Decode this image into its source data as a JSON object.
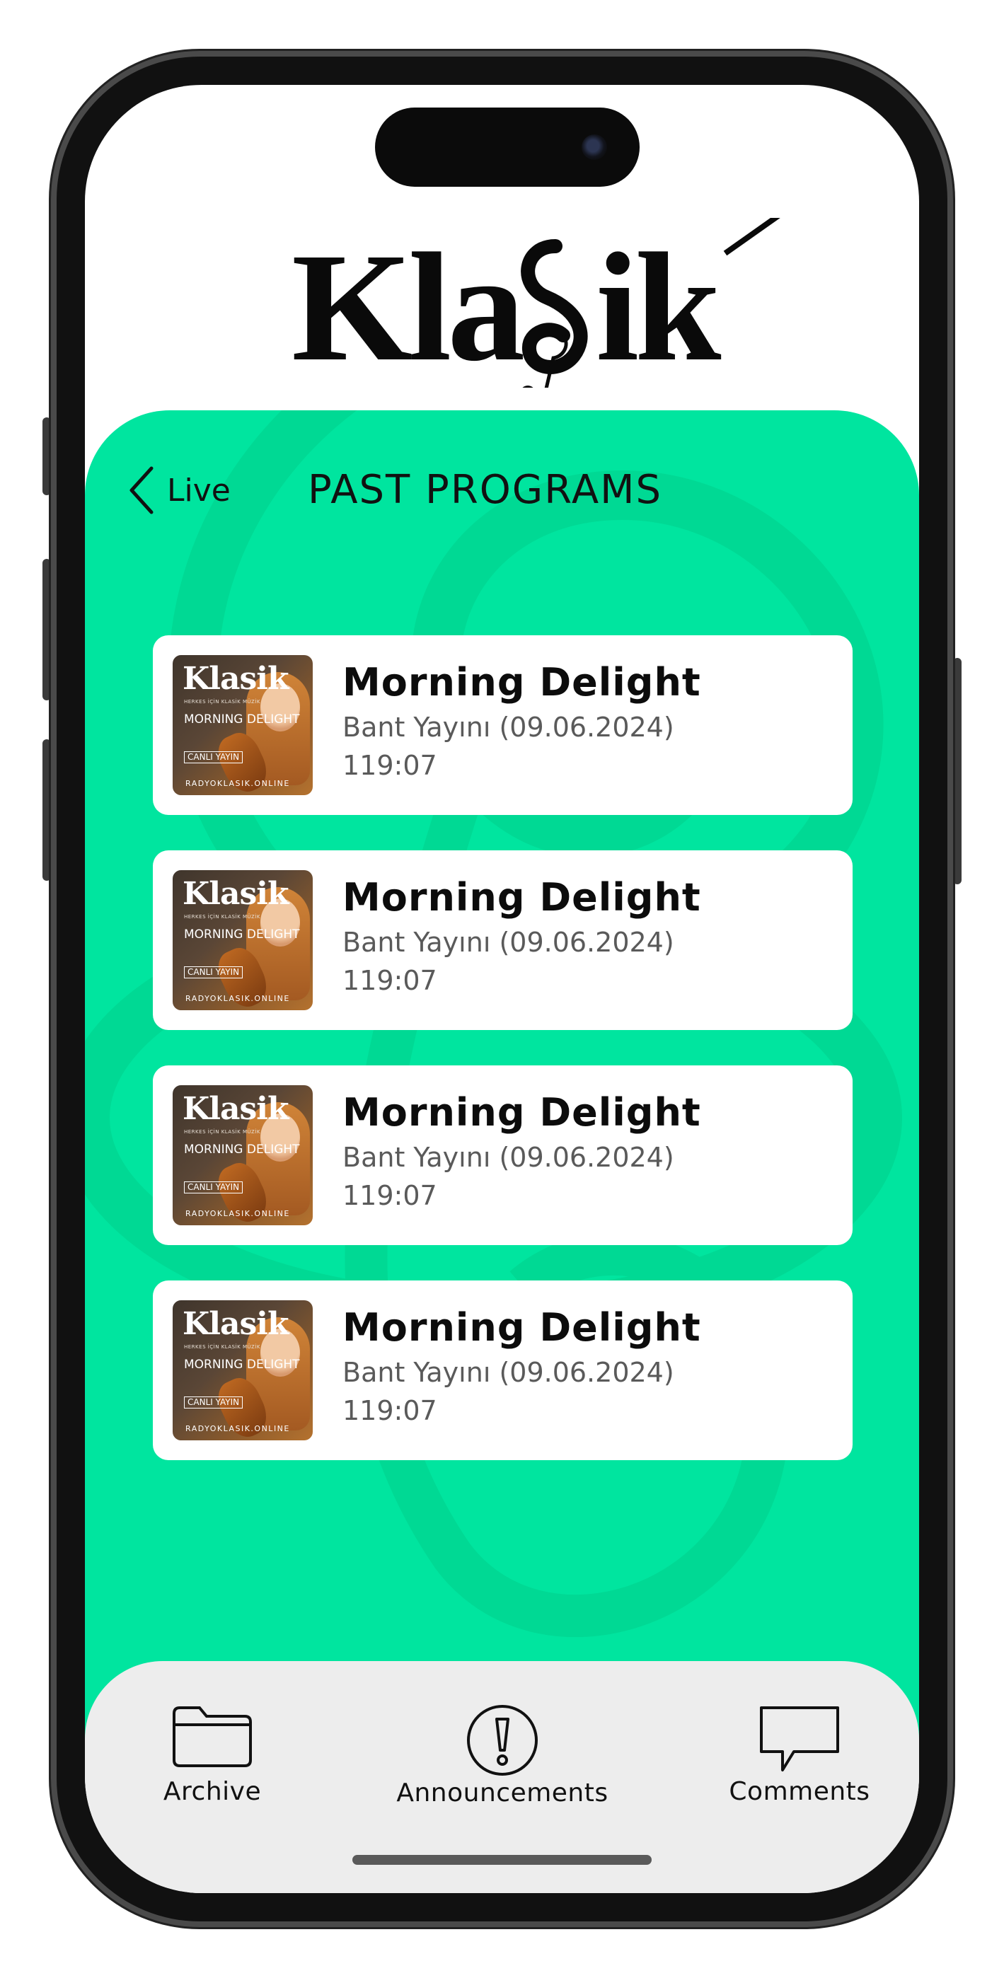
{
  "app": {
    "logo_text": "Klasik",
    "accent_color": "#00e59f"
  },
  "header": {
    "back_label": "Live",
    "title": "PAST PROGRAMS"
  },
  "programs": [
    {
      "title": "Morning Delight",
      "subtitle": "Bant Yayını (09.06.2024)",
      "duration": "119:07",
      "thumb": {
        "logo": "Klasik",
        "tagline": "HERKES İÇİN KLASİK MÜZİK",
        "show": "MORNING DELIGHT",
        "live": "CANLI YAYIN",
        "site": "RADYOKLASIK.ONLINE"
      }
    },
    {
      "title": "Morning Delight",
      "subtitle": "Bant Yayını (09.06.2024)",
      "duration": "119:07",
      "thumb": {
        "logo": "Klasik",
        "tagline": "HERKES İÇİN KLASİK MÜZİK",
        "show": "MORNING DELIGHT",
        "live": "CANLI YAYIN",
        "site": "RADYOKLASIK.ONLINE"
      }
    },
    {
      "title": "Morning Delight",
      "subtitle": "Bant Yayını (09.06.2024)",
      "duration": "119:07",
      "thumb": {
        "logo": "Klasik",
        "tagline": "HERKES İÇİN KLASİK MÜZİK",
        "show": "MORNING DELIGHT",
        "live": "CANLI YAYIN",
        "site": "RADYOKLASIK.ONLINE"
      }
    },
    {
      "title": "Morning Delight",
      "subtitle": "Bant Yayını (09.06.2024)",
      "duration": "119:07",
      "thumb": {
        "logo": "Klasik",
        "tagline": "HERKES İÇİN KLASİK MÜZİK",
        "show": "MORNING DELIGHT",
        "live": "CANLI YAYIN",
        "site": "RADYOKLASIK.ONLINE"
      }
    }
  ],
  "tabbar": {
    "items": [
      {
        "label": "Archive",
        "icon": "folder-icon"
      },
      {
        "label": "Announcements",
        "icon": "exclamation-circle-icon"
      },
      {
        "label": "Comments",
        "icon": "speech-bubble-icon"
      }
    ]
  }
}
